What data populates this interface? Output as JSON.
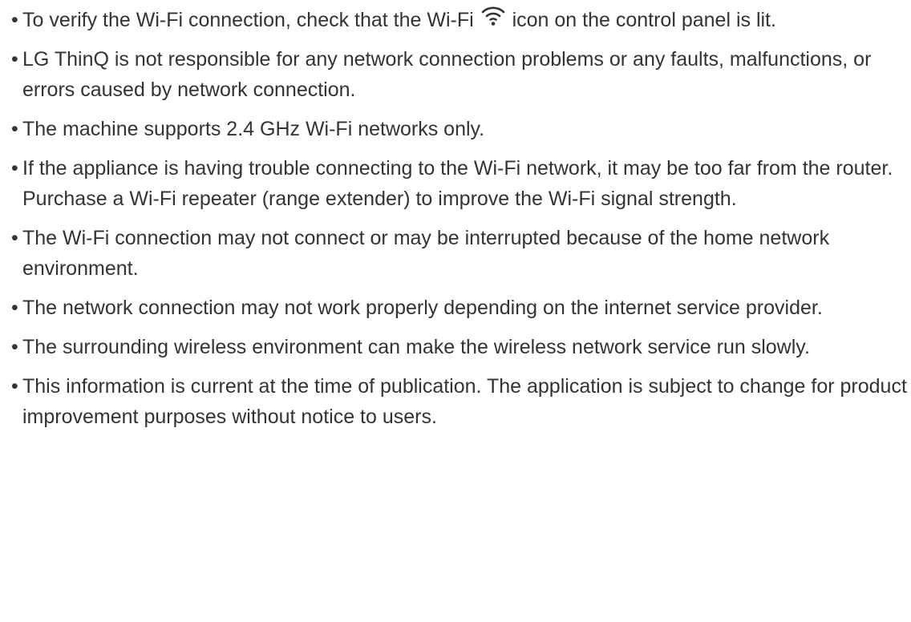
{
  "bullet_glyph": "•",
  "notes": [
    {
      "before_icon": "To verify the Wi-Fi connection, check that the Wi-Fi",
      "icon": "wifi-icon",
      "after_icon": "icon on the control panel is lit."
    },
    {
      "text": "LG ThinQ is not responsible for any network connection problems or any faults, malfunctions, or errors caused by network connection."
    },
    {
      "text": "The machine supports 2.4 GHz Wi-Fi networks only."
    },
    {
      "text": "If the appliance is having trouble connecting to the Wi-Fi network, it may be too far from the router. Purchase a Wi-Fi repeater (range extender) to improve the Wi-Fi signal strength."
    },
    {
      "text": "The Wi-Fi connection may not connect or may be interrupted because of the home network environment."
    },
    {
      "text": "The network connection may not work properly depending on the internet service provider."
    },
    {
      "text": "The surrounding wireless environment can make the wireless network service run slowly."
    },
    {
      "text": "This information is current at the time of publication. The application is subject to change for product improvement purposes without notice to users."
    }
  ],
  "colors": {
    "text": "#333333",
    "background": "#ffffff"
  }
}
